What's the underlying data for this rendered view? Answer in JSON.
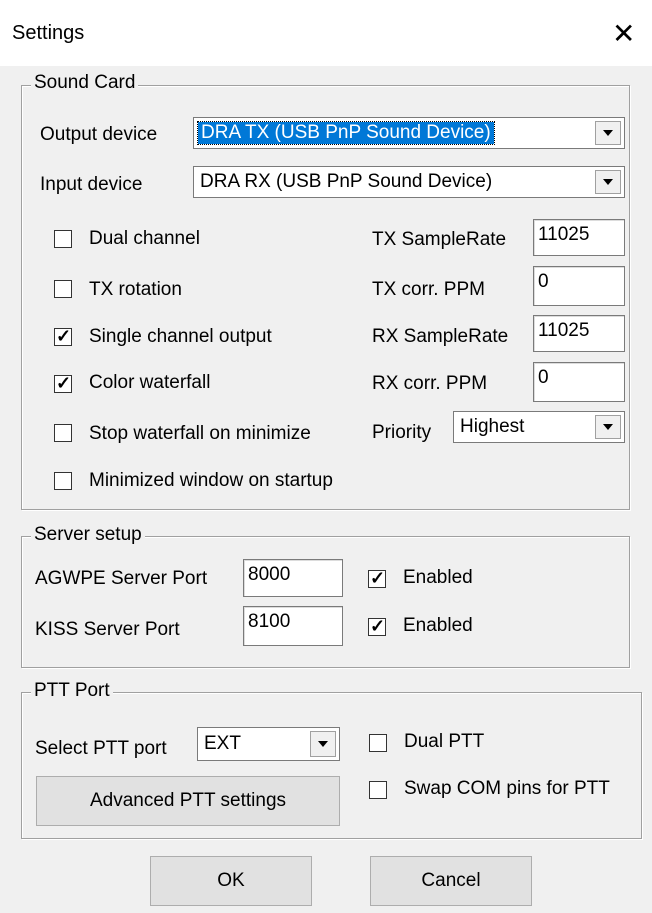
{
  "window": {
    "title": "Settings"
  },
  "sound_card": {
    "legend": "Sound Card",
    "output_device_label": "Output device",
    "output_device_value": "DRA TX (USB PnP Sound Device)",
    "input_device_label": "Input device",
    "input_device_value": "DRA RX (USB PnP Sound Device)",
    "checkboxes": [
      {
        "label": "Dual channel",
        "checked": false
      },
      {
        "label": "TX rotation",
        "checked": false
      },
      {
        "label": "Single channel output",
        "checked": true
      },
      {
        "label": "Color waterfall",
        "checked": true
      },
      {
        "label": "Stop waterfall on minimize",
        "checked": false
      },
      {
        "label": "Minimized window on startup",
        "checked": false
      }
    ],
    "tx_samplerate_label": "TX SampleRate",
    "tx_samplerate_value": "11025",
    "tx_corr_label": "TX corr. PPM",
    "tx_corr_value": "0",
    "rx_samplerate_label": "RX SampleRate",
    "rx_samplerate_value": "11025",
    "rx_corr_label": "RX corr. PPM",
    "rx_corr_value": "0",
    "priority_label": "Priority",
    "priority_value": "Highest"
  },
  "server_setup": {
    "legend": "Server setup",
    "agwpe_label": "AGWPE Server Port",
    "agwpe_value": "8000",
    "agwpe_enabled_label": "Enabled",
    "agwpe_enabled": true,
    "kiss_label": "KISS Server Port",
    "kiss_value": "8100",
    "kiss_enabled_label": "Enabled",
    "kiss_enabled": true
  },
  "ptt_port": {
    "legend": "PTT Port",
    "select_label": "Select PTT port",
    "select_value": "EXT",
    "dual_ptt_label": "Dual PTT",
    "dual_ptt": false,
    "swap_label": "Swap COM pins for PTT",
    "swap": false,
    "advanced_label": "Advanced PTT settings"
  },
  "buttons": {
    "ok": "OK",
    "cancel": "Cancel"
  },
  "icons": {
    "close": "close-icon",
    "check": "checkmark-icon",
    "dropdown": "chevron-down-icon"
  },
  "colors": {
    "selection": "#0078d7",
    "dialog_bg": "#f0f0f0"
  }
}
